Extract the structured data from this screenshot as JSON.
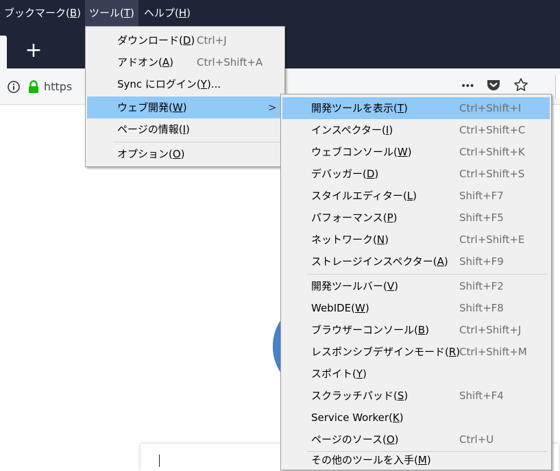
{
  "menubar": {
    "items": [
      {
        "label": "ブックマーク(",
        "key": "B",
        "close": ")"
      },
      {
        "label": "ツール(",
        "key": "T",
        "close": ")"
      },
      {
        "label": "ヘルプ(",
        "key": "H",
        "close": ")"
      }
    ]
  },
  "tabbar": {
    "new_tab": "+"
  },
  "navbar": {
    "url": "https",
    "page_actions_more": "•••"
  },
  "tools_menu": {
    "items": [
      {
        "label": "ダウンロード(",
        "key": "D",
        "close": ")",
        "shortcut": "Ctrl+J"
      },
      {
        "label": "アドオン(",
        "key": "A",
        "close": ")",
        "shortcut": "Ctrl+Shift+A"
      },
      {
        "label": "Sync にログイン(",
        "key": "Y",
        "close": ")...",
        "shortcut": ""
      },
      {
        "label": "ウェブ開発(",
        "key": "W",
        "close": ")",
        "shortcut": "",
        "arrow": ">"
      },
      {
        "label": "ページの情報(",
        "key": "I",
        "close": ")",
        "shortcut": ""
      },
      {
        "label": "オプション(",
        "key": "O",
        "close": ")",
        "shortcut": ""
      }
    ]
  },
  "webdev_menu": {
    "items": [
      {
        "label": "開発ツールを表示(",
        "key": "T",
        "close": ")",
        "shortcut": "Ctrl+Shift+I"
      },
      {
        "label": "インスペクター(",
        "key": "I",
        "close": ")",
        "shortcut": "Ctrl+Shift+C"
      },
      {
        "label": "ウェブコンソール(",
        "key": "W",
        "close": ")",
        "shortcut": "Ctrl+Shift+K"
      },
      {
        "label": "デバッガー(",
        "key": "D",
        "close": ")",
        "shortcut": "Ctrl+Shift+S"
      },
      {
        "label": "スタイルエディター(",
        "key": "L",
        "close": ")",
        "shortcut": "Shift+F7"
      },
      {
        "label": "パフォーマンス(",
        "key": "P",
        "close": ")",
        "shortcut": "Shift+F5"
      },
      {
        "label": "ネットワーク(",
        "key": "N",
        "close": ")",
        "shortcut": "Ctrl+Shift+E"
      },
      {
        "label": "ストレージインスペクター(",
        "key": "A",
        "close": ")",
        "shortcut": "Shift+F9"
      },
      {
        "label": "開発ツールバー(",
        "key": "V",
        "close": ")",
        "shortcut": "Shift+F2"
      },
      {
        "label": "WebIDE(",
        "key": "W",
        "close": ")",
        "shortcut": "Shift+F8"
      },
      {
        "label": "ブラウザーコンソール(",
        "key": "B",
        "close": ")",
        "shortcut": "Ctrl+Shift+J"
      },
      {
        "label": "レスポンシブデザインモード(",
        "key": "R",
        "close": ")",
        "shortcut": "Ctrl+Shift+M"
      },
      {
        "label": "スポイト(",
        "key": "Y",
        "close": ")",
        "shortcut": ""
      },
      {
        "label": "スクラッチパッド(",
        "key": "S",
        "close": ")",
        "shortcut": "Shift+F4"
      },
      {
        "label": "Service Worker(",
        "key": "K",
        "close": ")",
        "shortcut": ""
      },
      {
        "label": "ページのソース(",
        "key": "O",
        "close": ")",
        "shortcut": "Ctrl+U"
      },
      {
        "label": "その他のツールを入手(",
        "key": "M",
        "close": ")",
        "shortcut": ""
      }
    ]
  },
  "colors": {
    "chrome_dark": "#1f2437",
    "menu_bg": "#f0f0f0",
    "menu_highlight": "#91c9f7",
    "lock_green": "#12bc00",
    "ring_blue": "#4a7fc9"
  }
}
